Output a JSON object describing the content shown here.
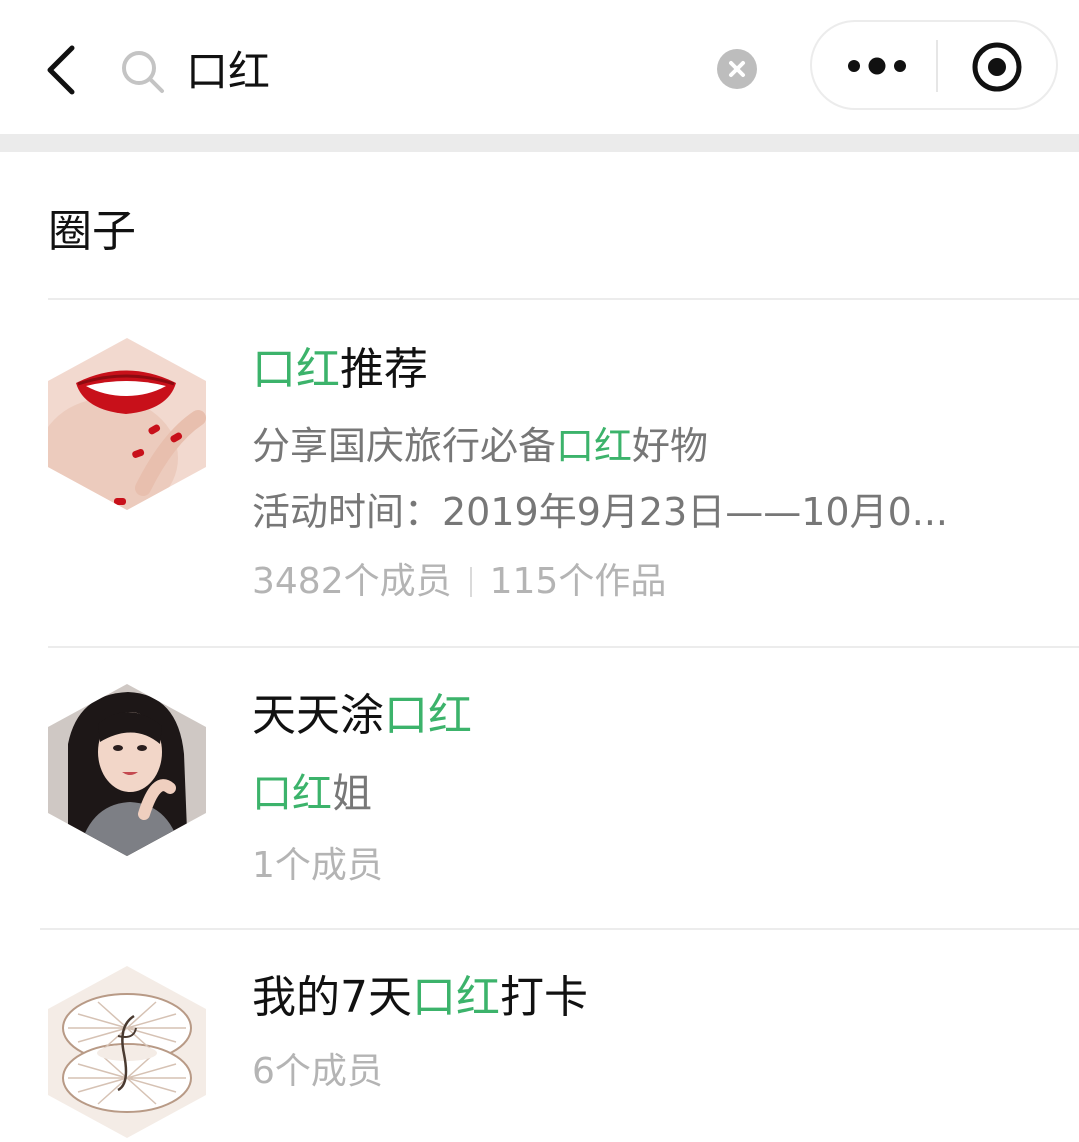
{
  "search": {
    "query": "口红"
  },
  "section": {
    "title": "圈子"
  },
  "colors": {
    "highlight": "#3cb36b",
    "meta": "#b4b4b4",
    "desc": "#777777"
  },
  "icons": {
    "back": "chevron-left-icon",
    "search": "search-icon",
    "clear": "clear-icon",
    "more": "more-dots-icon",
    "close": "target-circle-icon"
  },
  "results": [
    {
      "title_pre": "",
      "title_hl": "口红",
      "title_post": "推荐",
      "desc1_pre": "分享国庆旅行必备",
      "desc1_hl": "口红",
      "desc1_post": "好物",
      "desc2": "活动时间：2019年9月23日——10月0...",
      "members": "3482个成员",
      "works": "115个作品",
      "avatar": "red-lips-avatar"
    },
    {
      "title_pre": "天天涂",
      "title_hl": "口红",
      "title_post": "",
      "desc1_pre": "",
      "desc1_hl": "口红",
      "desc1_post": "姐",
      "members": "1个成员",
      "avatar": "girl-portrait-avatar"
    },
    {
      "title_pre": "我的7天",
      "title_hl": "口红",
      "title_post": "打卡",
      "members": "6个成员",
      "avatar": "shell-logo-avatar"
    }
  ]
}
